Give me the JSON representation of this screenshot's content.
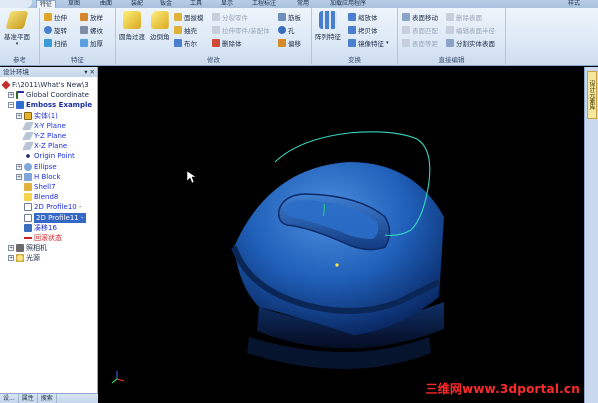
{
  "tabs": [
    "特征",
    "草图",
    "曲面",
    "装配",
    "钣金",
    "工具",
    "显示",
    "工程标注",
    "常用",
    "加载应用程序"
  ],
  "style_label": "样式",
  "ribbon": {
    "groups": [
      {
        "label": "参考",
        "big_button": "基准平面"
      },
      {
        "label": "特征",
        "buttons": [
          "拉伸",
          "旋转",
          "扫描",
          "放样",
          "螺纹",
          "加厚"
        ]
      },
      {
        "label": "修改",
        "big_buttons": [
          "圆角过渡",
          "边倒角"
        ],
        "buttons": [
          "面拔模",
          "抽壳",
          "布尔",
          "分裂零件",
          "拉伸零件/装配体",
          "删除体",
          "筋板",
          "孔",
          "偏移"
        ]
      },
      {
        "label": "变换",
        "big_button": "阵列特征",
        "buttons": [
          "缩放体",
          "拷贝体",
          "镜像特征"
        ]
      },
      {
        "label": "直接编辑",
        "buttons": [
          "表面移动",
          "表面匹配",
          "表面等距",
          "删除表面",
          "编辑表面半径",
          "分割实体表面"
        ]
      }
    ]
  },
  "panel": {
    "title": "设计环境",
    "controls": "▾ ✕",
    "tree": [
      {
        "label": "F:\\2011\\What's New\\3",
        "level": 0,
        "style": "normal"
      },
      {
        "label": "Global Coordinate",
        "level": 1,
        "style": "normal"
      },
      {
        "label": "Emboss Example",
        "level": 1,
        "style": "bold"
      },
      {
        "label": "实体(1)",
        "level": 2,
        "style": "blue"
      },
      {
        "label": "X-Y Plane",
        "level": 2,
        "style": "blue"
      },
      {
        "label": "Y-Z Plane",
        "level": 2,
        "style": "blue"
      },
      {
        "label": "X-Z Plane",
        "level": 2,
        "style": "blue"
      },
      {
        "label": "Origin Point",
        "level": 2,
        "style": "blue"
      },
      {
        "label": "Ellipse",
        "level": 2,
        "style": "blue"
      },
      {
        "label": "H Block",
        "level": 2,
        "style": "blue"
      },
      {
        "label": "Shell7",
        "level": 2,
        "style": "blue"
      },
      {
        "label": "Blend8",
        "level": 2,
        "style": "blue"
      },
      {
        "label": "2D Profile10 -",
        "level": 2,
        "style": "blue"
      },
      {
        "label": "2D Profile11 -",
        "level": 2,
        "style": "selected"
      },
      {
        "label": "凑移16",
        "level": 2,
        "style": "blue"
      },
      {
        "label": "回滚状态",
        "level": 2,
        "style": "red"
      },
      {
        "label": "照相机",
        "level": 0,
        "style": "normal"
      },
      {
        "label": "光源",
        "level": 0,
        "style": "normal"
      }
    ],
    "footer_tabs": [
      "设...",
      "属性",
      "搜索"
    ]
  },
  "right_tab": "设计元素库",
  "watermark": "三维网www.3dportal.cn",
  "colors": {
    "accent": "#3569c5",
    "part_blue": "#1f5fb8",
    "profile_cyan": "#35d6c0",
    "watermark": "#ff2a2a"
  }
}
